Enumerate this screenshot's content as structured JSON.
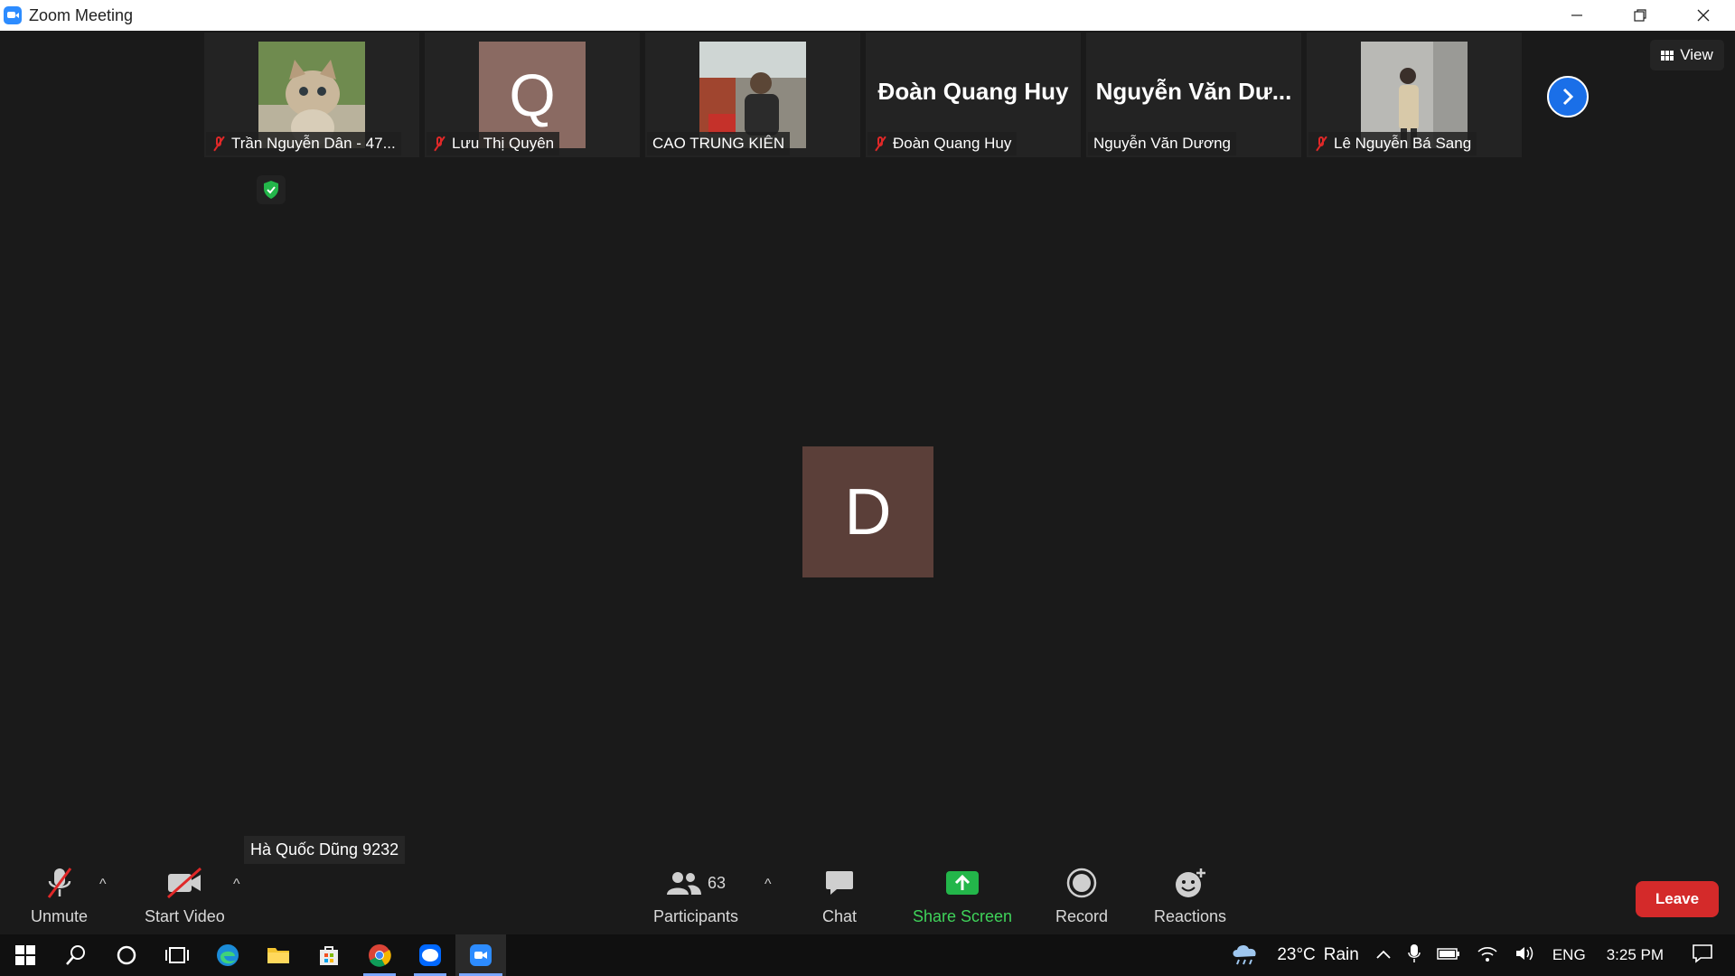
{
  "window": {
    "title": "Zoom Meeting",
    "controls": [
      "minimize-icon",
      "restore-icon",
      "close-icon"
    ]
  },
  "strip": {
    "tiles": [
      {
        "name": "Trần Nguyễn Dân - 47...",
        "muted": true,
        "avatar": "photo-cat"
      },
      {
        "name": "Lưu Thị Quyên",
        "muted": true,
        "initial": "Q"
      },
      {
        "name": "CAO TRUNG KIÊN",
        "muted": false,
        "avatar": "photo-man"
      },
      {
        "name": "Đoàn Quang Huy",
        "muted": true,
        "big_name": "Đoàn Quang Huy"
      },
      {
        "name": "Nguyễn Văn Dương",
        "muted": false,
        "big_name": "Nguyễn Văn Dư..."
      },
      {
        "name": "Lê Nguyễn Bá Sang",
        "muted": true,
        "avatar": "photo-person"
      }
    ],
    "next_icon": "chevron-right-icon"
  },
  "view_label": "View",
  "main_avatar_initial": "D",
  "active_speaker": "Hà Quốc Dũng 9232",
  "toolbar": {
    "unmute": "Unmute",
    "start_video": "Start Video",
    "participants": "Participants",
    "participants_count": "63",
    "chat": "Chat",
    "share_screen": "Share Screen",
    "record": "Record",
    "reactions": "Reactions",
    "leave": "Leave"
  },
  "taskbar": {
    "weather_temp": "23°C",
    "weather_text": "Rain",
    "language": "ENG",
    "time": "3:25 PM"
  },
  "colors": {
    "accent_blue": "#2d8cff",
    "share_green": "#3fd35a",
    "leave_red": "#d42a2a",
    "mute_red": "#e02828"
  }
}
